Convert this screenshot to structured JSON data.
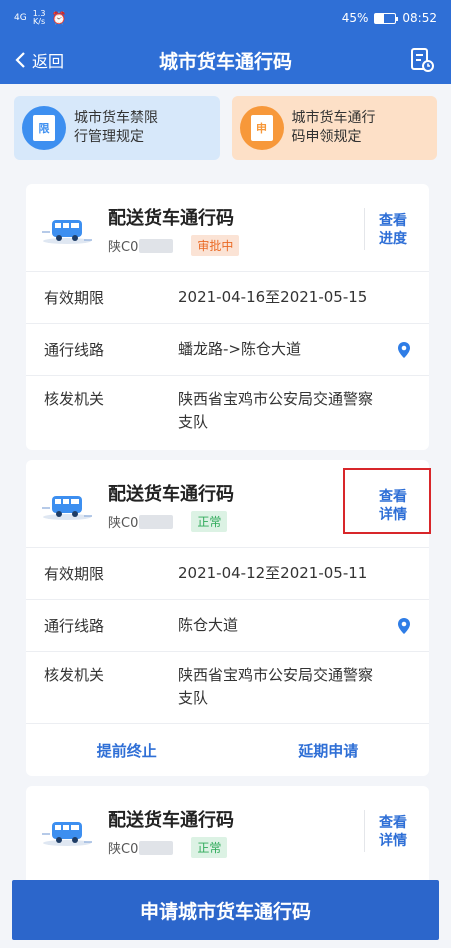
{
  "status_bar": {
    "signal": "4G",
    "speed_value": "1.3",
    "speed_unit": "K/s",
    "battery_percent": "45%",
    "battery_level": 0.45,
    "time": "08:52"
  },
  "nav": {
    "back_label": "返回",
    "title": "城市货车通行码"
  },
  "notices": [
    {
      "badge": "限",
      "text_line1": "城市货车禁限",
      "text_line2": "行管理规定"
    },
    {
      "badge": "申",
      "text_line1": "城市货车通行",
      "text_line2": "码申领规定"
    }
  ],
  "cards": [
    {
      "title": "配送货车通行码",
      "plate": "陕C0",
      "status": "审批中",
      "action_line1": "查看",
      "action_line2": "进度",
      "validity_label": "有效期限",
      "validity": "2021-04-16至2021-05-15",
      "route_label": "通行线路",
      "route": "蟠龙路->陈仓大道",
      "issuer_label": "核发机关",
      "issuer_line1": "陕西省宝鸡市公安局交通警察",
      "issuer_line2": "支队"
    },
    {
      "title": "配送货车通行码",
      "plate": "陕C0",
      "status": "正常",
      "action_line1": "查看",
      "action_line2": "详情",
      "validity_label": "有效期限",
      "validity": "2021-04-12至2021-05-11",
      "route_label": "通行线路",
      "route": "陈仓大道",
      "issuer_label": "核发机关",
      "issuer_line1": "陕西省宝鸡市公安局交通警察",
      "issuer_line2": "支队",
      "terminate_label": "提前终止",
      "extend_label": "延期申请"
    },
    {
      "title": "配送货车通行码",
      "plate": "陕C0",
      "status": "正常",
      "action_line1": "查看",
      "action_line2": "详情"
    }
  ],
  "apply_button": "申请城市货车通行码",
  "colors": {
    "primary": "#2f6fd6",
    "review": "#ea6a25",
    "normal": "#2faa5a",
    "highlight": "#d8262a"
  }
}
